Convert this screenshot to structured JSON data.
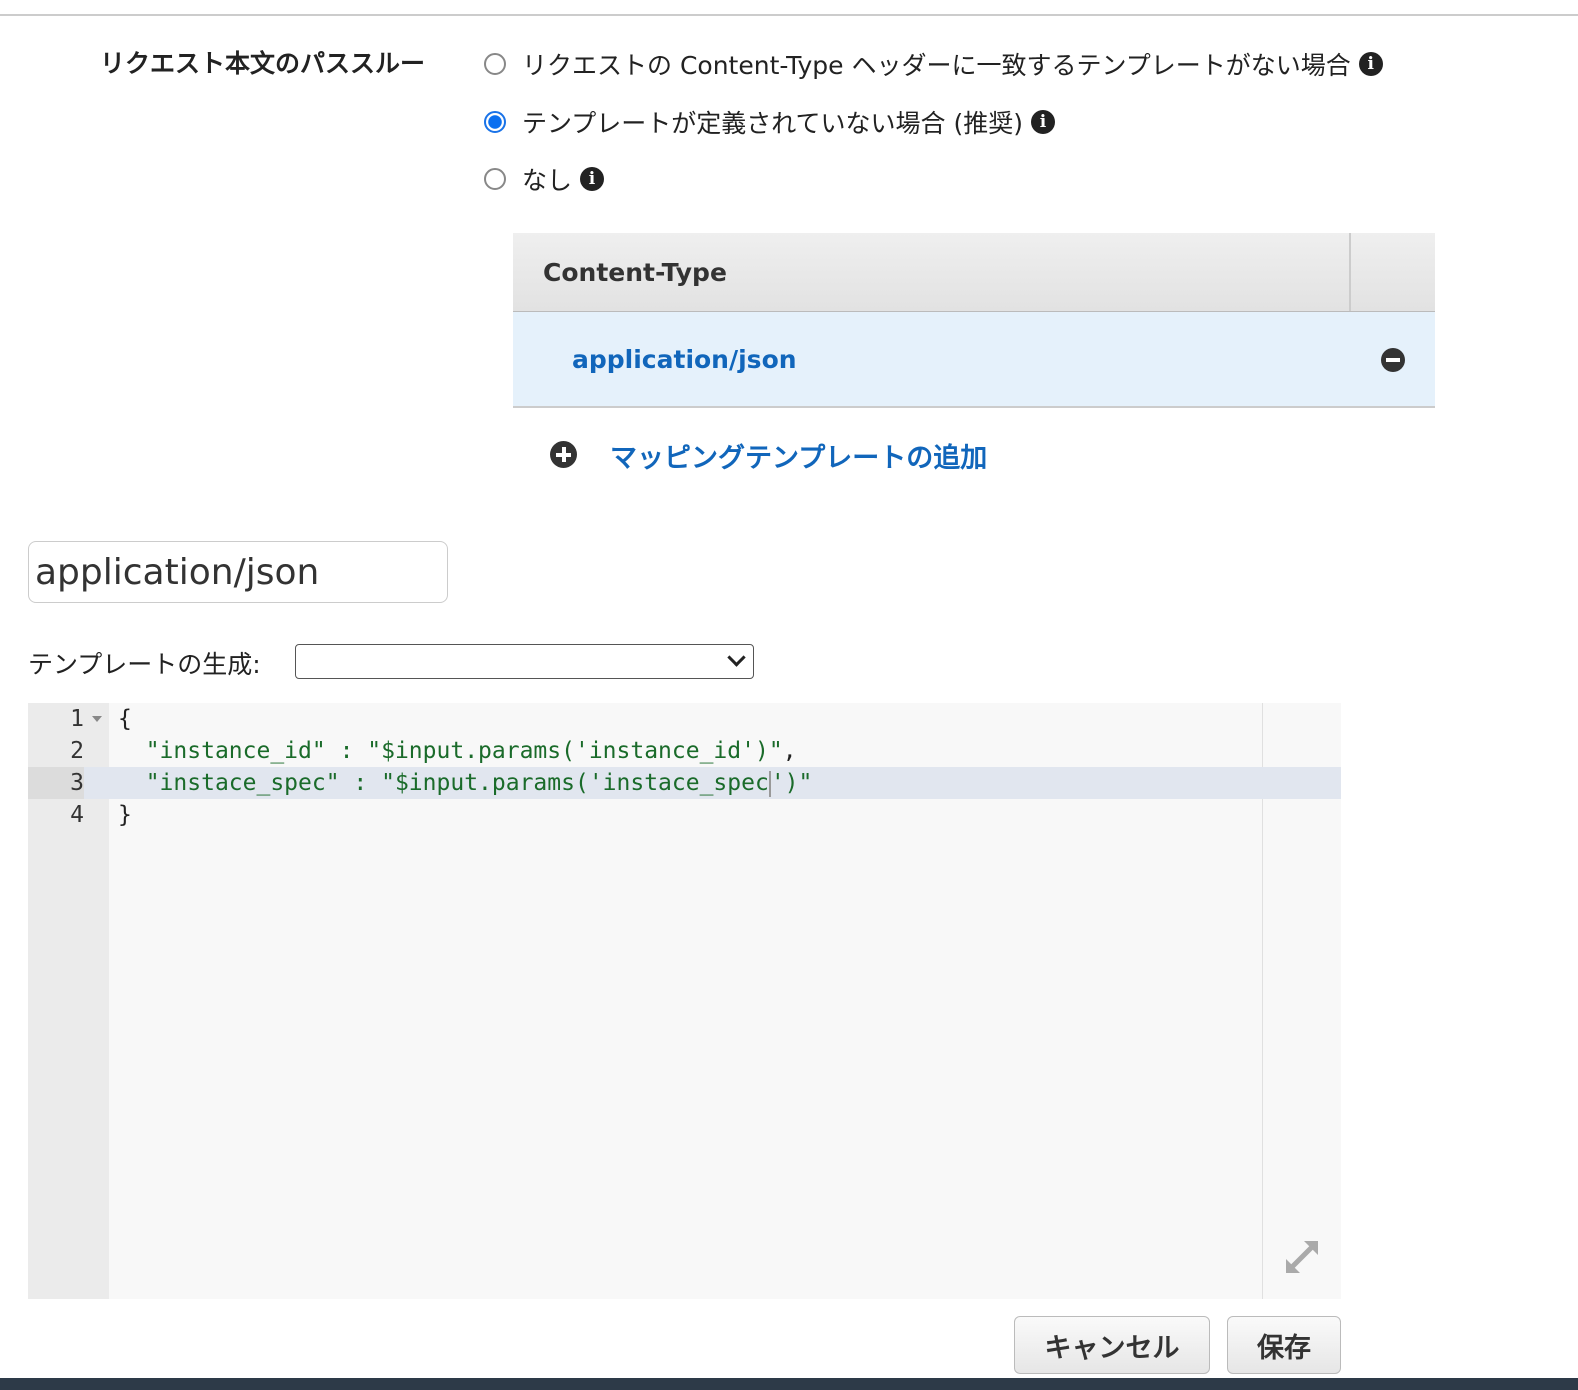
{
  "passthrough": {
    "label": "リクエスト本文のパススルー",
    "options": [
      {
        "label": "リクエストの Content-Type ヘッダーに一致するテンプレートがない場合",
        "selected": false
      },
      {
        "label": "テンプレートが定義されていない場合 (推奨)",
        "selected": true
      },
      {
        "label": "なし",
        "selected": false
      }
    ],
    "info_glyph": "i"
  },
  "table": {
    "header": "Content-Type",
    "rows": [
      "application/json"
    ]
  },
  "add_template_label": "マッピングテンプレートの追加",
  "content_type_input": "application/json",
  "generate": {
    "label": "テンプレートの生成:",
    "value": ""
  },
  "editor": {
    "lines": [
      {
        "n": "1",
        "pre": "{",
        "str": "",
        "post": ""
      },
      {
        "n": "2",
        "pre": "  ",
        "str": "\"instance_id\" : \"$input.params('instance_id')\"",
        "post": ","
      },
      {
        "n": "3",
        "pre": "  ",
        "str": "\"instace_spec\" : \"$input.params('instace_spec",
        "post2": "')\""
      },
      {
        "n": "4",
        "pre": "}",
        "str": "",
        "post": ""
      }
    ]
  },
  "buttons": {
    "cancel": "キャンセル",
    "save": "保存"
  }
}
